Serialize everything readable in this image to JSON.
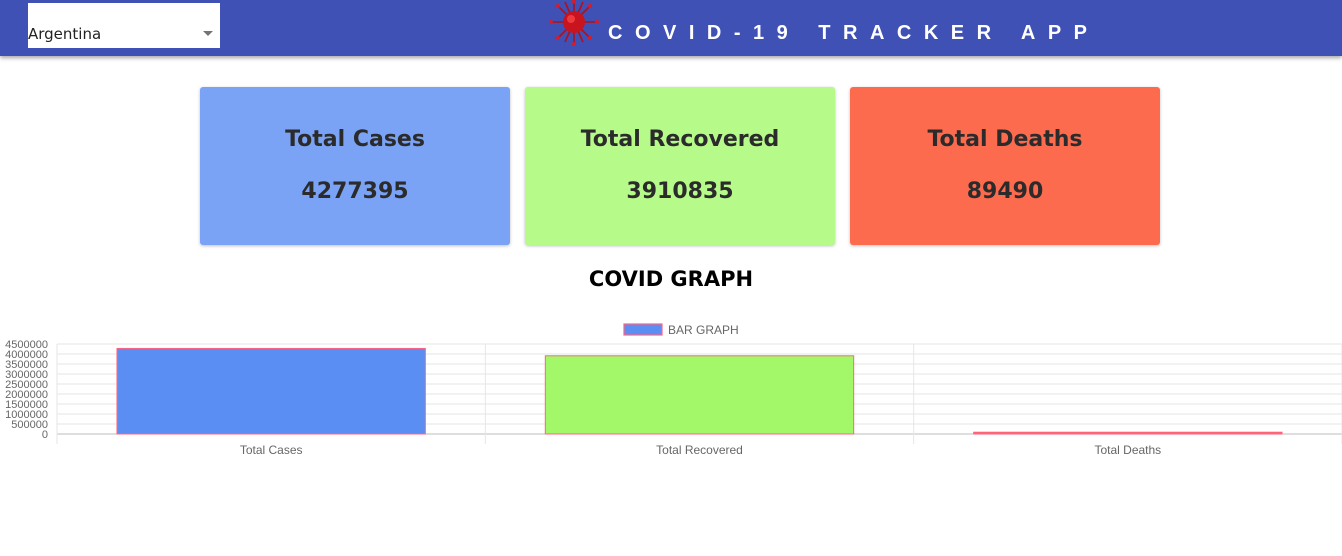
{
  "header": {
    "country_selected": "Argentina",
    "title": "COVID-19 TRACKER APP",
    "logo_icon": "virus-icon"
  },
  "cards": {
    "cases": {
      "label": "Total Cases",
      "value": "4277395",
      "color": "#7aa3f5"
    },
    "recovered": {
      "label": "Total Recovered",
      "value": "3910835",
      "color": "#b6fa8a"
    },
    "deaths": {
      "label": "Total Deaths",
      "value": "89490",
      "color": "#fd6b4f"
    }
  },
  "graph": {
    "heading": "COVID GRAPH"
  },
  "chart_data": {
    "type": "bar",
    "categories": [
      "Total Cases",
      "Total Recovered",
      "Total Deaths"
    ],
    "series": [
      {
        "name": "BAR GRAPH",
        "values": [
          4277395,
          3910835,
          89490
        ]
      }
    ],
    "bar_colors": [
      "#5b8ef2",
      "#a3f86a",
      "#fd6b4f"
    ],
    "border_color": "#ff6384",
    "legend_color": "#5b8ef2",
    "yticks": [
      "4500000",
      "4000000",
      "3500000",
      "3000000",
      "2500000",
      "2000000",
      "1500000",
      "1000000",
      "500000",
      "0"
    ],
    "ylim": [
      0,
      4500000
    ],
    "grid": true,
    "legend_position": "top"
  }
}
